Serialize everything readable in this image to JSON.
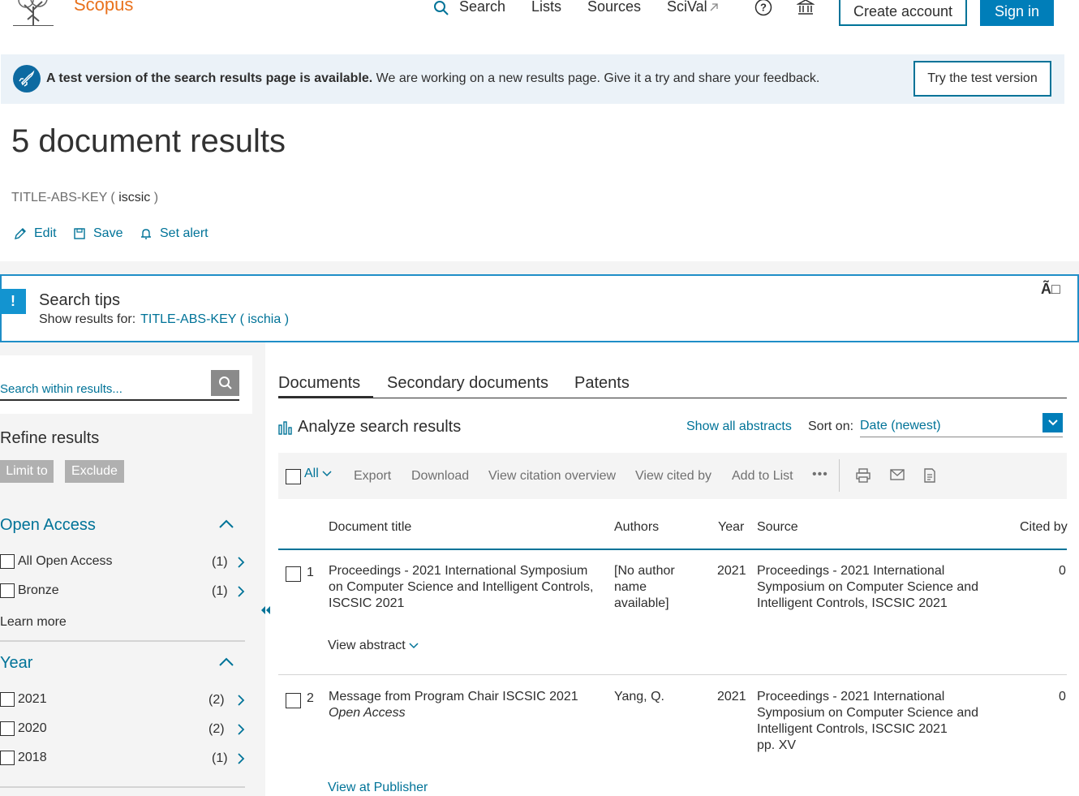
{
  "header": {
    "brand": "Scopus",
    "nav": {
      "search": "Search",
      "lists": "Lists",
      "sources": "Sources",
      "scival": "SciVal"
    },
    "create_account": "Create account",
    "sign_in": "Sign in"
  },
  "banner": {
    "bold": "A test version of the search results page is available.",
    "text": " We are working on a new results page. Give it a try and share your feedback.",
    "button": "Try the test version"
  },
  "results": {
    "title": "5 document results",
    "query_prefix": "TITLE-ABS-KEY ( ",
    "query_term": "iscsic",
    "query_suffix": " )",
    "actions": {
      "edit": "Edit",
      "save": "Save",
      "set_alert": "Set alert"
    }
  },
  "search_tips": {
    "bang": "!",
    "title": "Search tips",
    "show_label": "Show results for:",
    "show_link": "TITLE-ABS-KEY ( ischia )",
    "close": "Ã□"
  },
  "refine": {
    "search_placeholder": "Search within results...",
    "title": "Refine results",
    "limit_to": "Limit to",
    "exclude": "Exclude",
    "facets": {
      "open_access": {
        "title": "Open Access",
        "items": [
          {
            "label": "All Open Access",
            "count": "(1)"
          },
          {
            "label": "Bronze",
            "count": "(1)"
          }
        ],
        "learn_more": "Learn more"
      },
      "year": {
        "title": "Year",
        "items": [
          {
            "label": "2021",
            "count": "(2)"
          },
          {
            "label": "2020",
            "count": "(2)"
          },
          {
            "label": "2018",
            "count": "(1)"
          }
        ]
      }
    }
  },
  "tabs": {
    "documents": "Documents",
    "secondary": "Secondary documents",
    "patents": "Patents"
  },
  "analyze": "Analyze search results",
  "show_all_abstracts": "Show all abstracts",
  "sort": {
    "label": "Sort on:",
    "value": "Date (newest)"
  },
  "toolbar": {
    "all": "All",
    "export": "Export",
    "download": "Download",
    "citation_overview": "View citation overview",
    "cited_by": "View cited by",
    "add_to_list": "Add to List",
    "more": "•••"
  },
  "table": {
    "headers": {
      "title": "Document title",
      "authors": "Authors",
      "year": "Year",
      "source": "Source",
      "cited": "Cited by"
    },
    "rows": [
      {
        "num": "1",
        "title": "Proceedings - 2021 International Symposium on Computer Science and Intelligent Controls, ISCSIC 2021",
        "authors": "[No author name available]",
        "year": "2021",
        "source": "Proceedings - 2021 International Symposium on Computer Science and Intelligent Controls, ISCSIC 2021",
        "cited": "0",
        "link": "View abstract"
      },
      {
        "num": "2",
        "title": "Message from Program Chair ISCSIC 2021",
        "subtitle": "Open Access",
        "authors": "Yang, Q.",
        "year": "2021",
        "source": "Proceedings - 2021 International Symposium on Computer Science and Intelligent Controls, ISCSIC 2021",
        "pages": "pp. XV",
        "cited": "0",
        "link": "View at Publisher"
      }
    ]
  }
}
